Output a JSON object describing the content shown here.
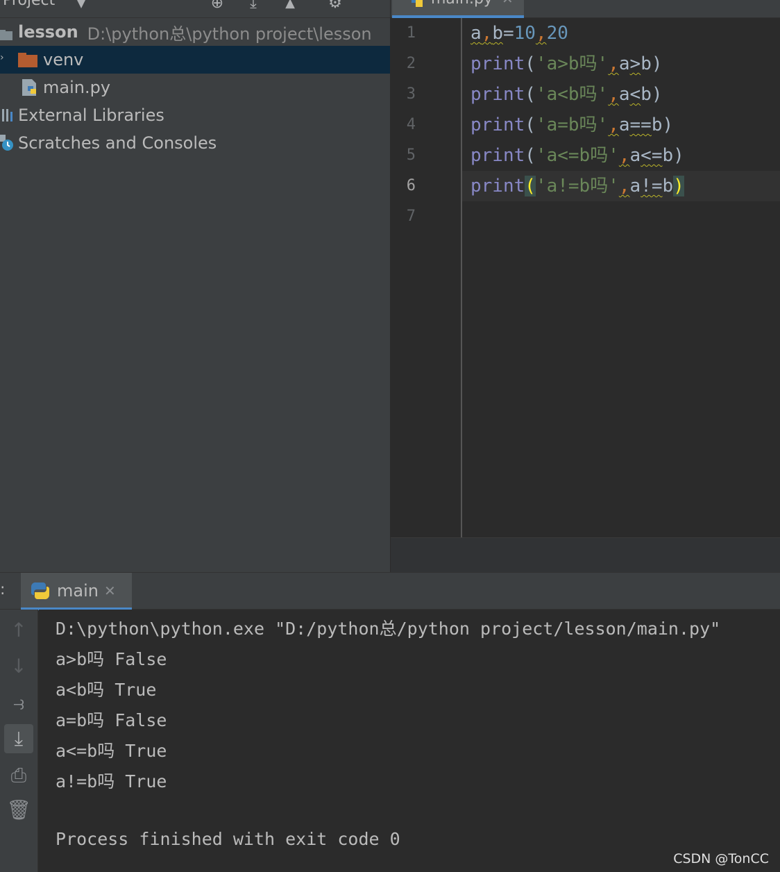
{
  "project": {
    "title": "Project",
    "root_name": "lesson",
    "root_path": "D:\\python总\\python project\\lesson",
    "items": [
      {
        "label": "venv",
        "type": "folder"
      },
      {
        "label": "main.py",
        "type": "python-file"
      },
      {
        "label": "External Libraries",
        "type": "libraries"
      },
      {
        "label": "Scratches and Consoles",
        "type": "scratches"
      }
    ]
  },
  "editor": {
    "tab_label": "main.py",
    "current_line": 6,
    "line_numbers": [
      "1",
      "2",
      "3",
      "4",
      "5",
      "6",
      "7"
    ],
    "tokens": {
      "l1": [
        "a",
        ",",
        "b",
        "=",
        "10",
        ",",
        "20"
      ],
      "print": "print",
      "open": "(",
      "close": ")",
      "comma": ",",
      "l2": [
        "'a>b吗'",
        "a",
        ">",
        "b"
      ],
      "l3": [
        "'a<b吗'",
        "a",
        "<",
        "b"
      ],
      "l4": [
        "'a=b吗'",
        "a",
        "==",
        "b"
      ],
      "l5": [
        "'a<=b吗'",
        "a",
        "<=",
        "b"
      ],
      "l6": [
        "'a!=b吗'",
        "a",
        "!=",
        "b"
      ]
    }
  },
  "run": {
    "tab_label": "main",
    "console_lines": [
      "D:\\python\\python.exe \"D:/python总/python project/lesson/main.py\"",
      "a>b吗 False",
      "a<b吗 True",
      "a=b吗 False",
      "a<=b吗 True",
      "a!=b吗 True",
      "",
      "Process finished with exit code 0"
    ]
  },
  "watermark": "CSDN @TonCC",
  "colors": {
    "keyword": "#8888c6",
    "string": "#6a8759",
    "number": "#6897bb",
    "selection": "#0d293e",
    "tab_underline": "#4a88c7"
  }
}
